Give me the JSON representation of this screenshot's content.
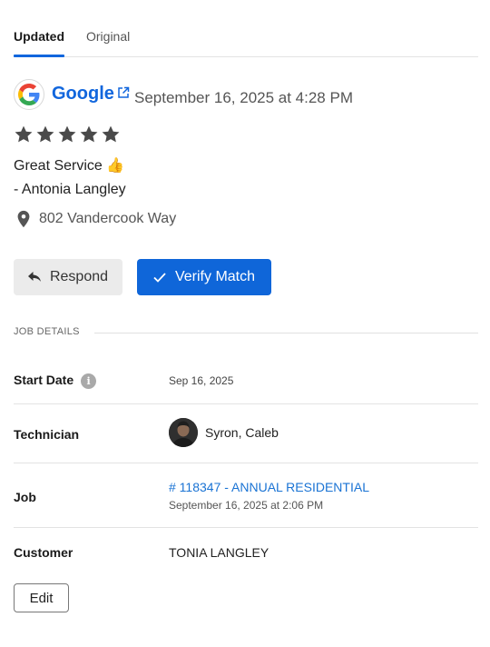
{
  "tabs": [
    {
      "label": "Updated",
      "active": true
    },
    {
      "label": "Original",
      "active": false
    }
  ],
  "review": {
    "source": "Google",
    "source_icon": "google-logo",
    "date": "September 16, 2025 at 4:28 PM",
    "rating": 5,
    "rating_max": 5,
    "text": "Great Service 👍",
    "reviewer": "- Antonia Langley",
    "location": "802 Vandercook Way"
  },
  "actions": {
    "respond_label": "Respond",
    "verify_label": "Verify Match"
  },
  "job_details": {
    "section_label": "JOB DETAILS",
    "start_date": {
      "label": "Start Date",
      "value": "Sep 16, 2025"
    },
    "technician": {
      "label": "Technician",
      "value": "Syron, Caleb"
    },
    "job": {
      "label": "Job",
      "link": "# 118347 - ANNUAL RESIDENTIAL",
      "date": "September 16, 2025 at 2:06 PM"
    },
    "customer": {
      "label": "Customer",
      "value": "TONIA LANGLEY"
    }
  },
  "edit_label": "Edit",
  "colors": {
    "accent": "#1166dd",
    "primary_button": "#0f66d9",
    "star": "#4a4a4a"
  }
}
